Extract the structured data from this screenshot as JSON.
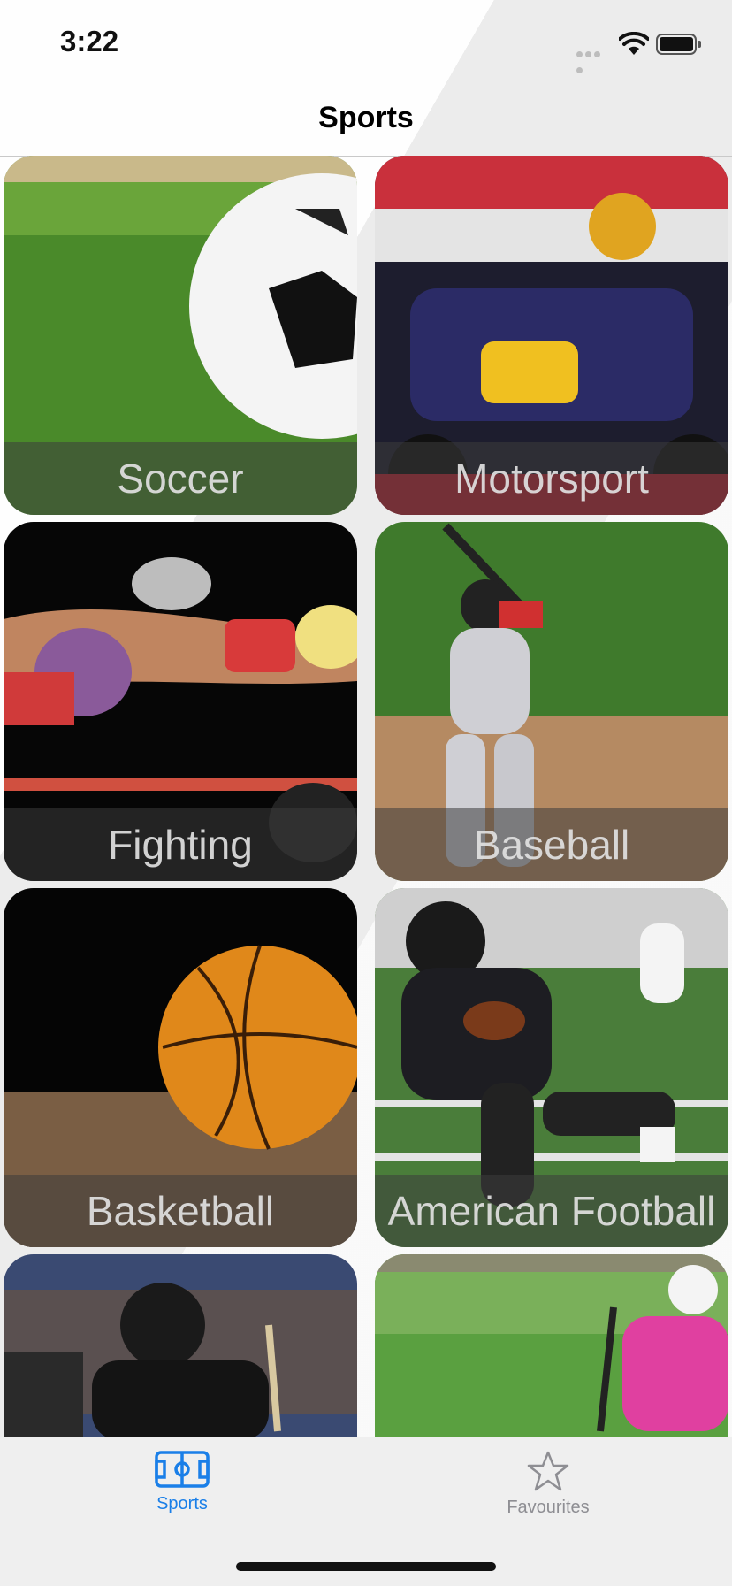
{
  "status_bar": {
    "time": "3:22"
  },
  "nav": {
    "title": "Sports"
  },
  "tiles": [
    {
      "label": "Soccer"
    },
    {
      "label": "Motorsport"
    },
    {
      "label": "Fighting"
    },
    {
      "label": "Baseball"
    },
    {
      "label": "Basketball"
    },
    {
      "label": "American Football"
    },
    {
      "label": ""
    },
    {
      "label": ""
    }
  ],
  "tab_bar": {
    "items": [
      {
        "label": "Sports",
        "icon": "stadium-field-icon",
        "selected": true
      },
      {
        "label": "Favourites",
        "icon": "star-icon",
        "selected": false
      }
    ]
  },
  "colors": {
    "accent": "#1a7fe8",
    "inactive": "#8e8e93"
  }
}
